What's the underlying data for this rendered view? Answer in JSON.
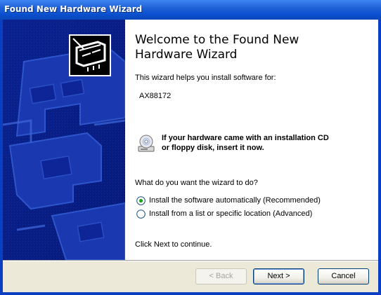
{
  "window": {
    "title": "Found New Hardware Wizard"
  },
  "content": {
    "heading": "Welcome to the Found New Hardware Wizard",
    "intro": "This wizard helps you install software for:",
    "device": "AX88172",
    "cd_notice_line1": "If your hardware came with an installation CD",
    "cd_notice_line2": "or floppy disk, insert it now.",
    "question": "What do you want the wizard to do?",
    "options": [
      {
        "label": "Install the software automatically (Recommended)",
        "selected": true
      },
      {
        "label": "Install from a list or specific location (Advanced)",
        "selected": false
      }
    ],
    "next_hint": "Click Next to continue."
  },
  "buttons": {
    "back": "< Back",
    "next": "Next >",
    "cancel": "Cancel"
  },
  "icons": {
    "sidebar_graphic": "hardware-wizard-banner",
    "device_icon": "hardware-board-icon",
    "cd_icon": "cd-drive-icon"
  },
  "colors": {
    "titlebar": "#0a4fce",
    "sidebar": "#0a1f8f",
    "footer": "#ece9d8"
  }
}
